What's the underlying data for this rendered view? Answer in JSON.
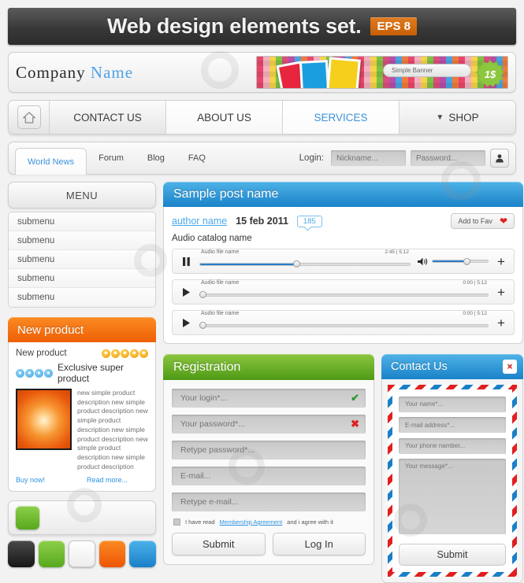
{
  "titlebar": {
    "title": "Web design elements set.",
    "badge": "EPS 8"
  },
  "company": {
    "name1": "Company",
    "name2": "Name"
  },
  "banner": {
    "label": "Simple Banner",
    "price": "1$"
  },
  "mainnav": {
    "home_icon": "home-icon",
    "items": [
      {
        "label": "CONTACT US",
        "style": "grey"
      },
      {
        "label": "ABOUT US",
        "style": "white"
      },
      {
        "label": "SERVICES",
        "style": "active"
      },
      {
        "label": "SHOP",
        "style": "grey",
        "caret": "▼"
      }
    ]
  },
  "tabsbar": {
    "tabs": [
      {
        "label": "World News",
        "active": true
      },
      {
        "label": "Forum",
        "active": false
      },
      {
        "label": "Blog",
        "active": false
      },
      {
        "label": "FAQ",
        "active": false
      }
    ],
    "login_label": "Login:",
    "nickname_placeholder": "Nickname...",
    "password_placeholder": "Password..."
  },
  "menu": {
    "header": "MENU",
    "items": [
      "submenu",
      "submenu",
      "submenu",
      "submenu",
      "submenu"
    ]
  },
  "new_product": {
    "header": "New product",
    "title": "New product",
    "subtitle": "Exclusive super product",
    "rating": 5,
    "description": "new simple product description new simple product description new simple product description new simple product description new simple product description new simple product description",
    "buy_link": "Buy now!",
    "read_link": "Read more..."
  },
  "post": {
    "header": "Sample post name",
    "author": "author name",
    "date": "15 feb 2011",
    "comments": "185",
    "fav_label": "Add to Fav",
    "catalog": "Audio catalog name",
    "tracks": [
      {
        "name": "Audio file name",
        "time": "2:45 | 5:12",
        "progress": 46,
        "state": "pause",
        "has_volume": true,
        "volume": 62
      },
      {
        "name": "Audio file name",
        "time": "0:00 | 5:12",
        "progress": 0,
        "state": "play",
        "has_volume": false
      },
      {
        "name": "Audio file name",
        "time": "0:00 | 5:12",
        "progress": 0,
        "state": "play",
        "has_volume": false
      }
    ]
  },
  "registration": {
    "header": "Registration",
    "fields": [
      {
        "placeholder": "Your login*...",
        "mark": "ok"
      },
      {
        "placeholder": "Your password*...",
        "mark": "bad"
      },
      {
        "placeholder": "Retype password*...",
        "mark": ""
      },
      {
        "placeholder": "E-mail...",
        "mark": ""
      },
      {
        "placeholder": "Retype e-mail...",
        "mark": ""
      }
    ],
    "agree_pre": "I have read",
    "agree_link": "Membership Agreement",
    "agree_post": "and i agree with it",
    "submit": "Submit",
    "login": "Log In"
  },
  "contact": {
    "header": "Contact Us",
    "close": "×",
    "name_placeholder": "Your name*...",
    "email_placeholder": "E-mail address*...",
    "phone_placeholder": "Your phone namber...",
    "message_placeholder": "Your message*...",
    "submit": "Submit"
  },
  "colors": {
    "accent_blue": "#1a82c8",
    "accent_green": "#4e9a16",
    "accent_orange": "#ee5f06",
    "link": "#2f93e0"
  },
  "swatches": [
    "black",
    "green",
    "white",
    "orange",
    "blue"
  ]
}
